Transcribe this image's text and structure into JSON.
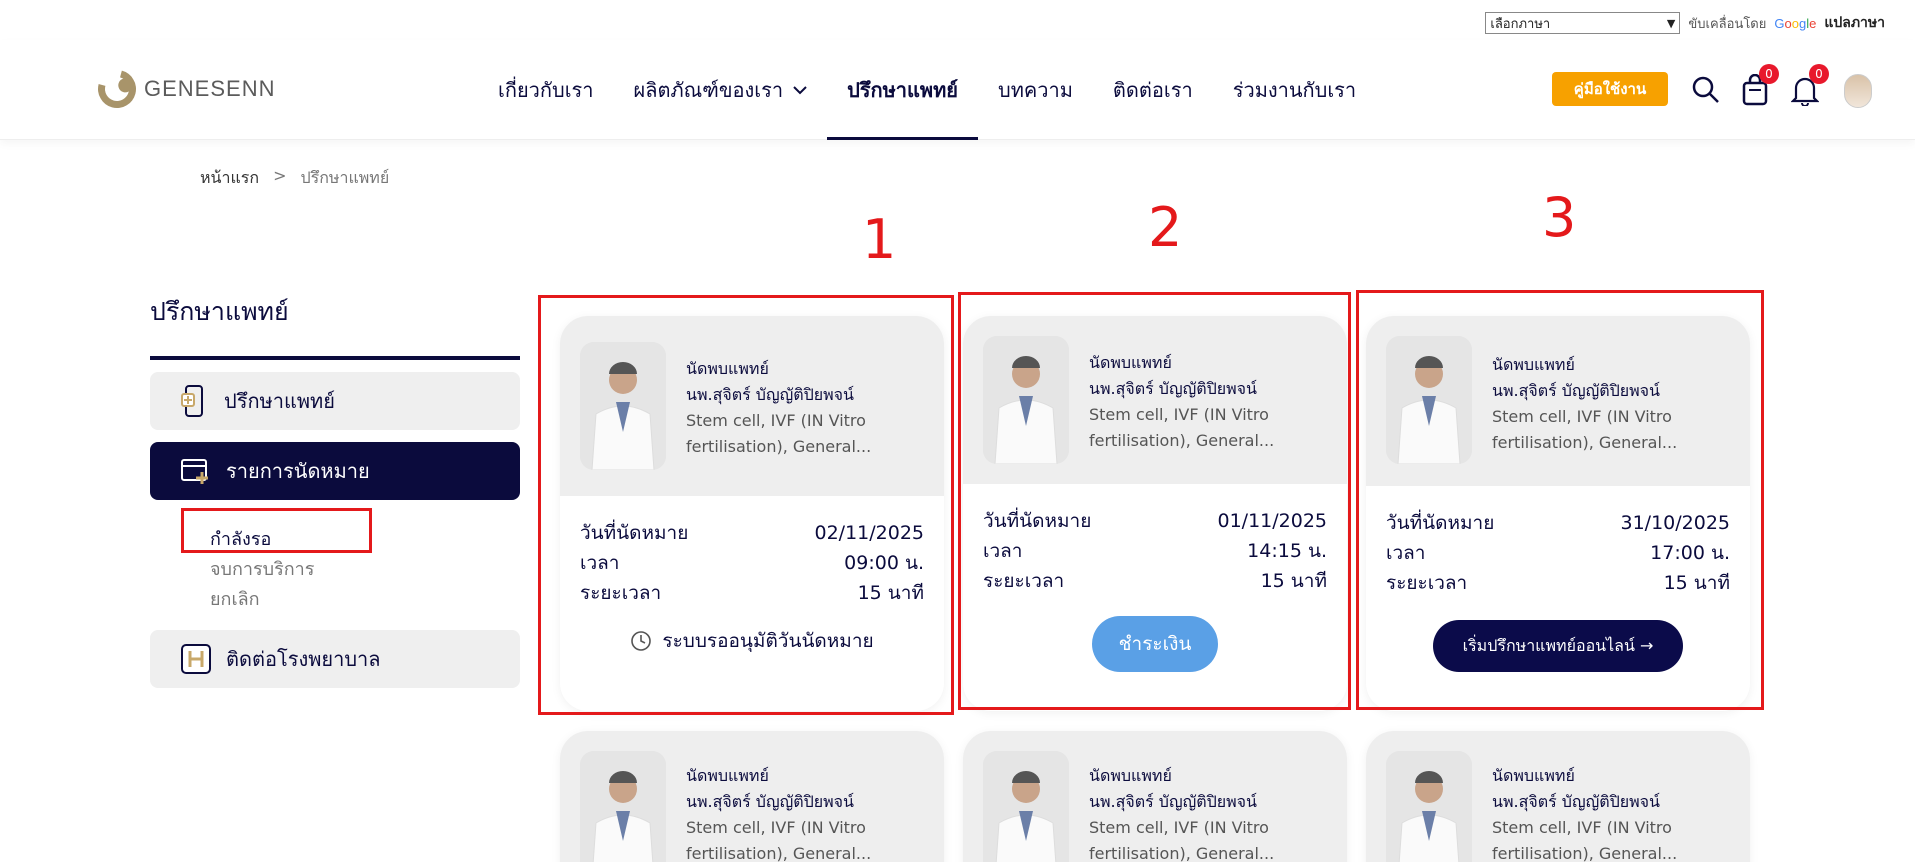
{
  "translate": {
    "select_value": "เลือกภาษา",
    "powered_by": "ขับเคลื่อนโดย",
    "google": "Google",
    "translate_link": "แปลภาษา"
  },
  "header": {
    "logo_text": "GENESENN",
    "nav": [
      {
        "label": "เกี่ยวกับเรา"
      },
      {
        "label": "ผลิตภัณฑ์ของเรา"
      },
      {
        "label": "ปรึกษาแพทย์"
      },
      {
        "label": "บทความ"
      },
      {
        "label": "ติดต่อเรา"
      },
      {
        "label": "ร่วมงานกับเรา"
      }
    ],
    "manual_button": "คู่มือใช้งาน",
    "cart_count": "0",
    "notif_count": "0"
  },
  "breadcrumb": {
    "home": "หน้าแรก",
    "sep": ">",
    "current": "ปรึกษาแพทย์"
  },
  "annotations": {
    "n1": "1",
    "n2": "2",
    "n3": "3"
  },
  "sidebar": {
    "title": "ปรึกษาแพทย์",
    "items": [
      {
        "label": "ปรึกษาแพทย์"
      },
      {
        "label": "รายการนัดหมาย"
      },
      {
        "label": "ติดต่อโรงพยาบาล"
      }
    ],
    "sub_items": [
      {
        "label": "กำลังรอ"
      },
      {
        "label": "จบการบริการ"
      },
      {
        "label": "ยกเลิก"
      }
    ]
  },
  "cards": [
    {
      "heading": "นัดพบแพทย์",
      "doctor": "นพ.สุจิตร์ บัญญัติปิยพจน์",
      "spec1": "Stem cell, IVF (IN Vitro",
      "spec2": "fertilisation), General...",
      "date_label": "วันที่นัดหมาย",
      "date": "02/11/2025",
      "time_label": "เวลา",
      "time": "09:00 น.",
      "duration_label": "ระยะเวลา",
      "duration": "15 นาที",
      "status": "ระบบรออนุมัติวันนัดหมาย"
    },
    {
      "heading": "นัดพบแพทย์",
      "doctor": "นพ.สุจิตร์ บัญญัติปิยพจน์",
      "spec1": "Stem cell, IVF (IN Vitro",
      "spec2": "fertilisation), General...",
      "date_label": "วันที่นัดหมาย",
      "date": "01/11/2025",
      "time_label": "เวลา",
      "time": "14:15 น.",
      "duration_label": "ระยะเวลา",
      "duration": "15 นาที",
      "button": "ชำระเงิน"
    },
    {
      "heading": "นัดพบแพทย์",
      "doctor": "นพ.สุจิตร์ บัญญัติปิยพจน์",
      "spec1": "Stem cell, IVF (IN Vitro",
      "spec2": "fertilisation), General...",
      "date_label": "วันที่นัดหมาย",
      "date": "31/10/2025",
      "time_label": "เวลา",
      "time": "17:00 น.",
      "duration_label": "ระยะเวลา",
      "duration": "15 นาที",
      "button": "เริ่มปรึกษาแพทย์ออนไลน์ →"
    },
    {
      "heading": "นัดพบแพทย์",
      "doctor": "นพ.สุจิตร์ บัญญัติปิยพจน์",
      "spec1": "Stem cell, IVF (IN Vitro",
      "spec2": "fertilisation), General..."
    },
    {
      "heading": "นัดพบแพทย์",
      "doctor": "นพ.สุจิตร์ บัญญัติปิยพจน์",
      "spec1": "Stem cell, IVF (IN Vitro",
      "spec2": "fertilisation), General..."
    },
    {
      "heading": "นัดพบแพทย์",
      "doctor": "นพ.สุจิตร์ บัญญัติปิยพจน์",
      "spec1": "Stem cell, IVF (IN Vitro",
      "spec2": "fertilisation), General..."
    }
  ],
  "colors": {
    "navy": "#0b0b3d",
    "orange": "#f7a100",
    "red": "#e4191b",
    "blue": "#5aa0e6"
  }
}
